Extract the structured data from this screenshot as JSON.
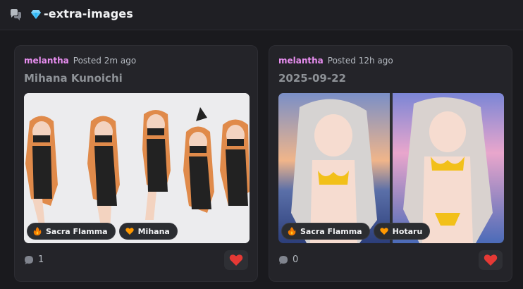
{
  "channel": {
    "name": "-extra-images"
  },
  "posts": [
    {
      "author": "melantha",
      "posted": "Posted 2m ago",
      "title": "Mihana Kunoichi",
      "tags": [
        {
          "icon": "fire-icon",
          "label": "Sacra Flamma"
        },
        {
          "icon": "orange-heart-icon",
          "label": "Mihana"
        }
      ],
      "comments": "1",
      "reaction": "red-heart-icon"
    },
    {
      "author": "melantha",
      "posted": "Posted 12h ago",
      "title": "2025-09-22",
      "tags": [
        {
          "icon": "fire-icon",
          "label": "Sacra Flamma"
        },
        {
          "icon": "orange-heart-icon",
          "label": "Hotaru"
        }
      ],
      "comments": "0",
      "reaction": "red-heart-icon"
    }
  ],
  "colors": {
    "author": "#e88ef0",
    "background": "#1a1a1e",
    "card": "#242429"
  }
}
